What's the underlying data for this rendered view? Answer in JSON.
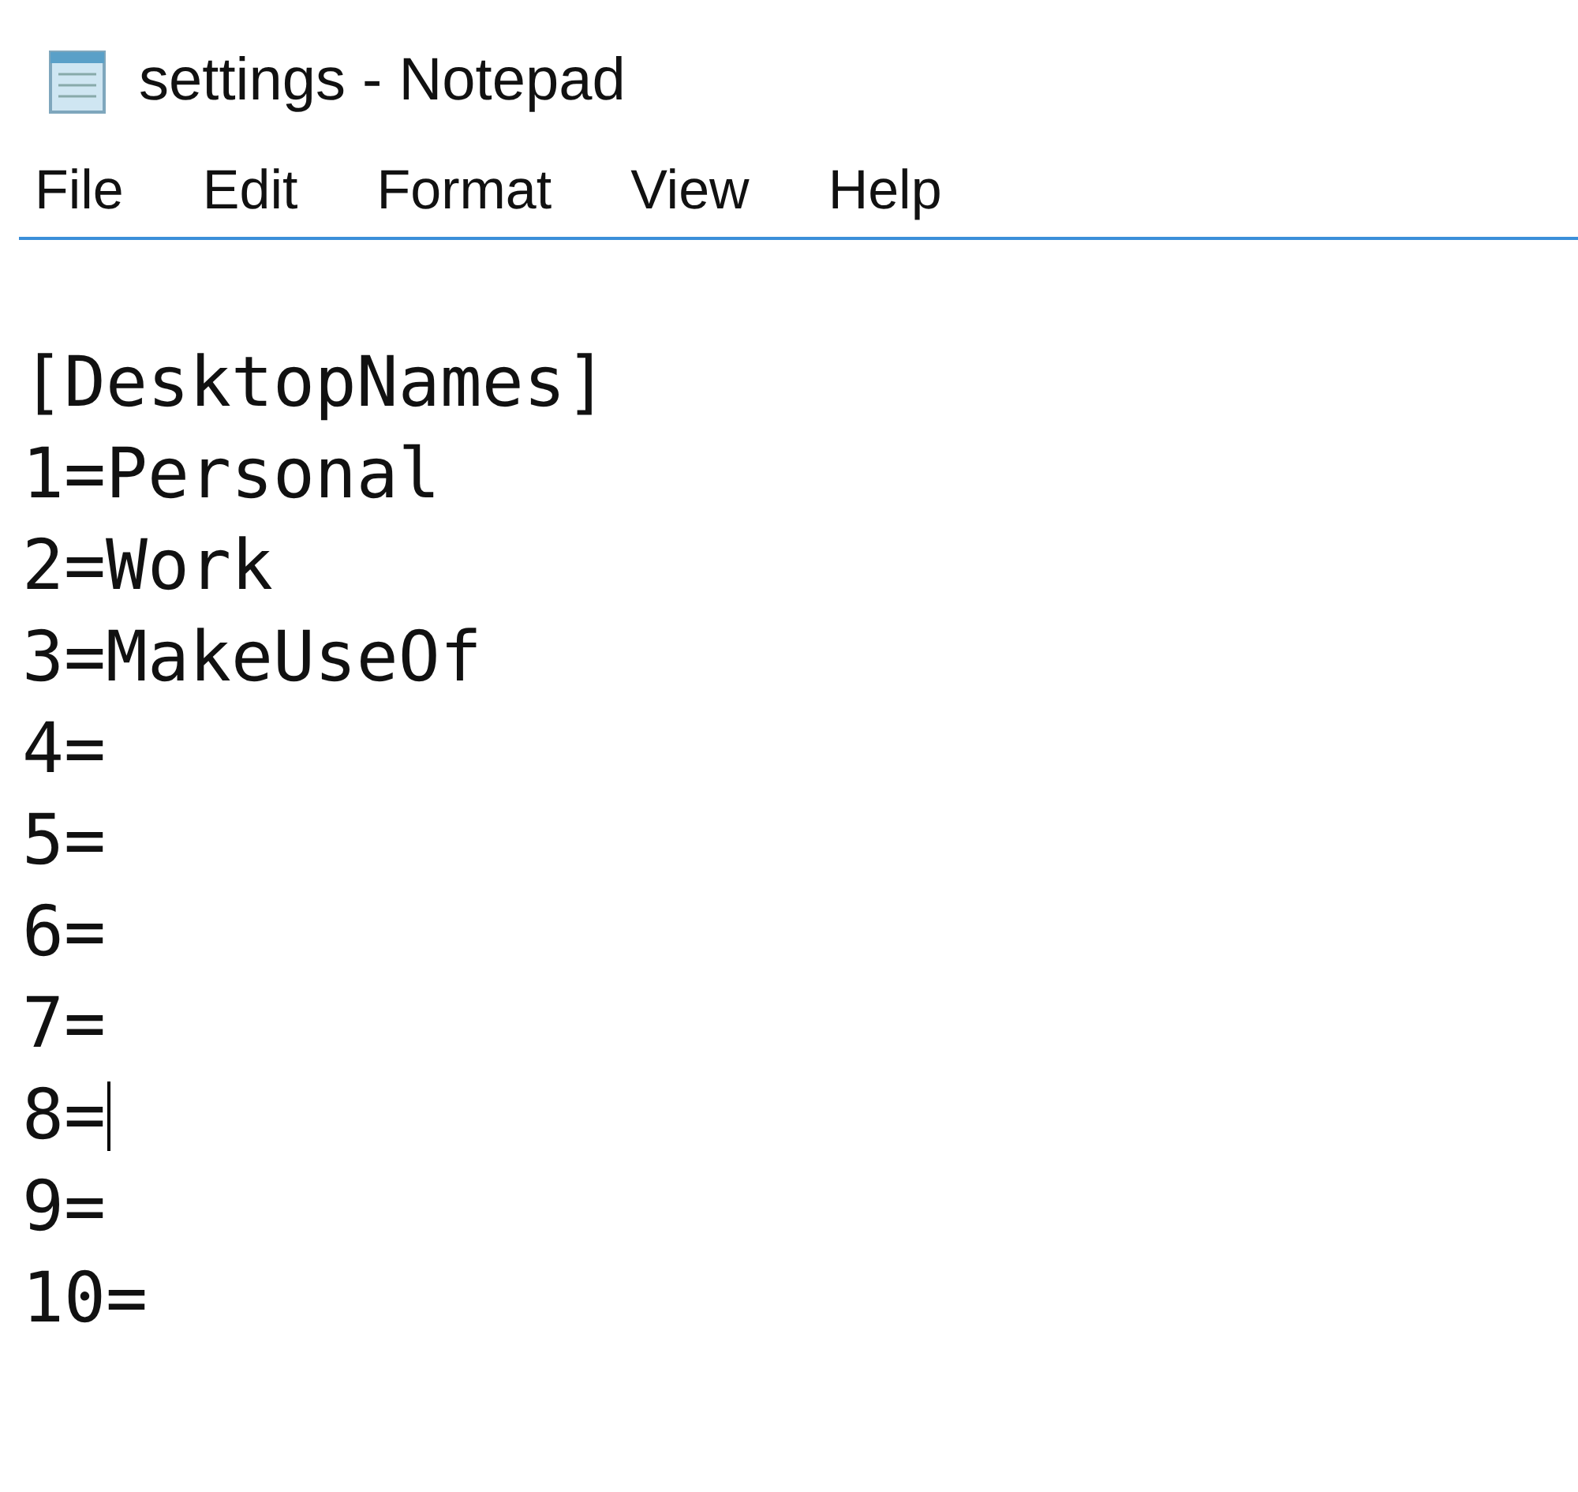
{
  "window": {
    "title": "settings - Notepad"
  },
  "menu": [
    "File",
    "Edit",
    "Format",
    "View",
    "Help"
  ],
  "document": {
    "lines": [
      {
        "text": "[DesktopNames]",
        "caret": false
      },
      {
        "text": "1=Personal",
        "caret": false
      },
      {
        "text": "2=Work",
        "caret": false
      },
      {
        "text": "3=MakeUseOf",
        "caret": false
      },
      {
        "text": "4=",
        "caret": false
      },
      {
        "text": "5=",
        "caret": false
      },
      {
        "text": "6=",
        "caret": false
      },
      {
        "text": "7=",
        "caret": false
      },
      {
        "text": "8=",
        "caret": true
      },
      {
        "text": "9=",
        "caret": false
      },
      {
        "text": "10=",
        "caret": false
      }
    ]
  }
}
